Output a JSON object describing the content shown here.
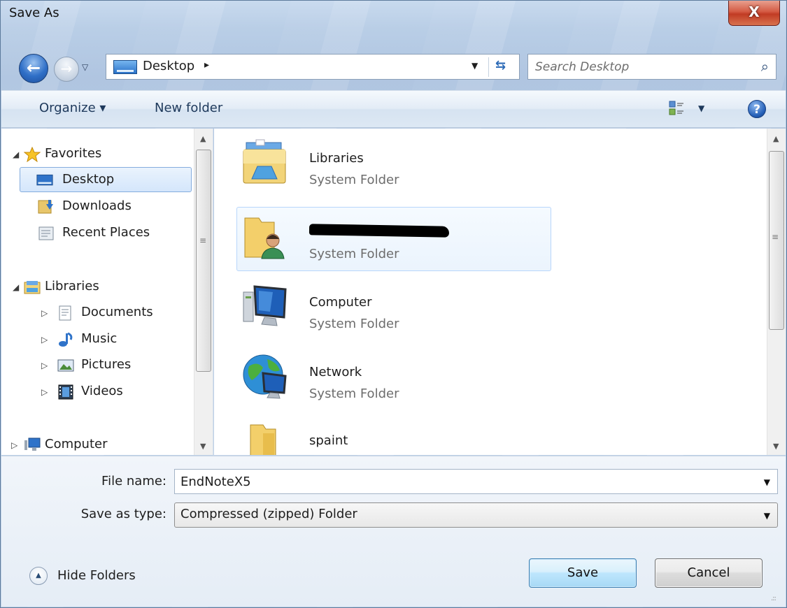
{
  "window": {
    "title": "Save As",
    "close_glyph": "X"
  },
  "address": {
    "location": "Desktop",
    "chevron": "▸",
    "search_placeholder": "Search Desktop"
  },
  "toolbar": {
    "organize_label": "Organize ▾",
    "new_folder_label": "New folder",
    "view_icon": "view-options-icon",
    "help_glyph": "?"
  },
  "navigation": {
    "groups": [
      {
        "label": "Favorites",
        "icon": "star-icon",
        "children": [
          {
            "label": "Desktop",
            "icon": "desktop-icon",
            "selected": true
          },
          {
            "label": "Downloads",
            "icon": "downloads-icon"
          },
          {
            "label": "Recent Places",
            "icon": "recent-places-icon"
          }
        ]
      },
      {
        "label": "Libraries",
        "icon": "libraries-icon",
        "children": [
          {
            "label": "Documents",
            "icon": "documents-icon"
          },
          {
            "label": "Music",
            "icon": "music-icon"
          },
          {
            "label": "Pictures",
            "icon": "pictures-icon"
          },
          {
            "label": "Videos",
            "icon": "videos-icon"
          }
        ]
      },
      {
        "label": "Computer",
        "icon": "computer-icon",
        "children": []
      }
    ]
  },
  "files": [
    {
      "name": "Libraries",
      "type": "System Folder",
      "icon": "libraries-folder-icon"
    },
    {
      "name": "",
      "type": "System Folder",
      "icon": "user-folder-icon",
      "redacted": true
    },
    {
      "name": "Computer",
      "type": "System Folder",
      "icon": "computer-icon"
    },
    {
      "name": "Network",
      "type": "System Folder",
      "icon": "network-icon"
    },
    {
      "name": "spaint",
      "type": "",
      "icon": "folder-icon"
    }
  ],
  "form": {
    "file_name_label": "File name:",
    "file_name_value": "EndNoteX5",
    "save_type_label": "Save as type:",
    "save_type_value": "Compressed (zipped) Folder"
  },
  "footer": {
    "hide_folders_label": "Hide Folders",
    "save_label": "Save",
    "cancel_label": "Cancel"
  },
  "colors": {
    "selection_border": "#84acdd",
    "hover_border": "#b8d6fb",
    "close_button": "#c13b24"
  }
}
